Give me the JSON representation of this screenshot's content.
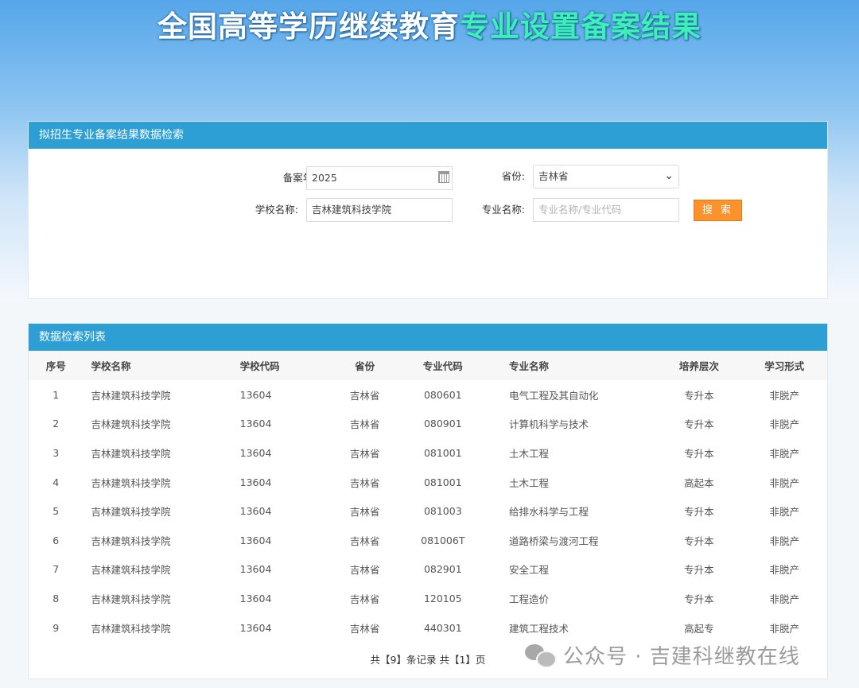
{
  "header": {
    "title_part1": "全国高等学历继续教育",
    "title_part2": "专业设置备案结果"
  },
  "search": {
    "panel_title": "拟招生专业备案结果数据检索",
    "year_label": "备案年份:",
    "year_value": "2025",
    "province_label": "省份:",
    "province_value": "吉林省",
    "school_label": "学校名称:",
    "school_value": "吉林建筑科技学院",
    "major_label": "专业名称:",
    "major_placeholder": "专业名称/专业代码",
    "search_button": "搜 索"
  },
  "list": {
    "panel_title": "数据检索列表",
    "columns": [
      "序号",
      "学校名称",
      "学校代码",
      "省份",
      "专业代码",
      "专业名称",
      "培养层次",
      "学习形式"
    ],
    "rows": [
      [
        "1",
        "吉林建筑科技学院",
        "13604",
        "吉林省",
        "080601",
        "电气工程及其自动化",
        "专升本",
        "非脱产"
      ],
      [
        "2",
        "吉林建筑科技学院",
        "13604",
        "吉林省",
        "080901",
        "计算机科学与技术",
        "专升本",
        "非脱产"
      ],
      [
        "3",
        "吉林建筑科技学院",
        "13604",
        "吉林省",
        "081001",
        "土木工程",
        "专升本",
        "非脱产"
      ],
      [
        "4",
        "吉林建筑科技学院",
        "13604",
        "吉林省",
        "081001",
        "土木工程",
        "高起本",
        "非脱产"
      ],
      [
        "5",
        "吉林建筑科技学院",
        "13604",
        "吉林省",
        "081003",
        "给排水科学与工程",
        "专升本",
        "非脱产"
      ],
      [
        "6",
        "吉林建筑科技学院",
        "13604",
        "吉林省",
        "081006T",
        "道路桥梁与渡河工程",
        "专升本",
        "非脱产"
      ],
      [
        "7",
        "吉林建筑科技学院",
        "13604",
        "吉林省",
        "082901",
        "安全工程",
        "专升本",
        "非脱产"
      ],
      [
        "8",
        "吉林建筑科技学院",
        "13604",
        "吉林省",
        "120105",
        "工程造价",
        "专升本",
        "非脱产"
      ],
      [
        "9",
        "吉林建筑科技学院",
        "13604",
        "吉林省",
        "440301",
        "建筑工程技术",
        "高起专",
        "非脱产"
      ]
    ],
    "pager": "共【9】条记录 共【1】页"
  },
  "watermark": {
    "text": "公众号 · 吉建科继教在线",
    "icon": "wechat-icon"
  },
  "colors": {
    "panel_header": "#2d9fd4",
    "search_button": "#fb922c",
    "title_accent": "#3ef0b8"
  }
}
